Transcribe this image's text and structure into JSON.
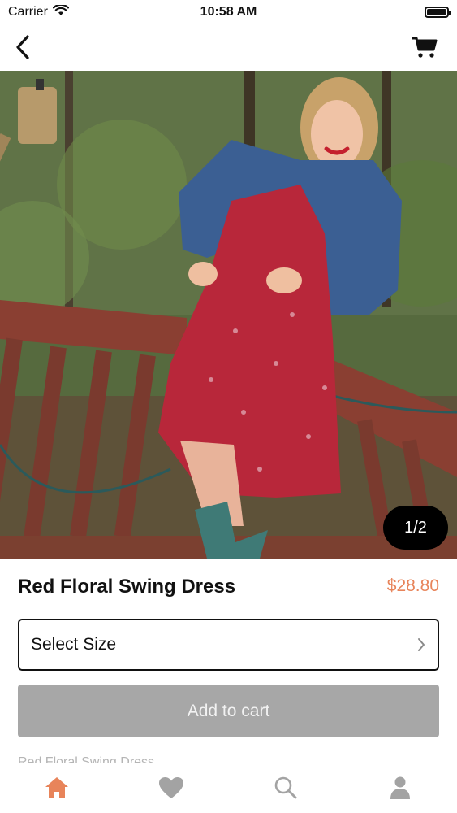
{
  "status_bar": {
    "carrier": "Carrier",
    "time": "10:58 AM",
    "battery_level": 0.95
  },
  "nav": {
    "back_icon": "chevron-left-icon",
    "cart_icon": "cart-icon"
  },
  "gallery": {
    "page_indicator": "1/2",
    "image_alt": "Woman wearing a red floral swing dress and denim jacket on a wooden deck"
  },
  "product": {
    "title": "Red Floral Swing Dress",
    "price": "$28.80",
    "size_select_label": "Select Size",
    "add_to_cart_label": "Add to cart",
    "description_peek": "Red Floral Swing Dress"
  },
  "tabs": [
    {
      "name": "home",
      "icon": "home-icon",
      "active": true
    },
    {
      "name": "favorites",
      "icon": "heart-icon",
      "active": false
    },
    {
      "name": "search",
      "icon": "search-icon",
      "active": false
    },
    {
      "name": "profile",
      "icon": "user-icon",
      "active": false
    }
  ],
  "colors": {
    "accent": "#e8845a",
    "inactive_icon": "#a3a3a3",
    "button_disabled": "#a7a7a7",
    "photo_dress": "#b8273a",
    "photo_jacket": "#3a5f94"
  }
}
